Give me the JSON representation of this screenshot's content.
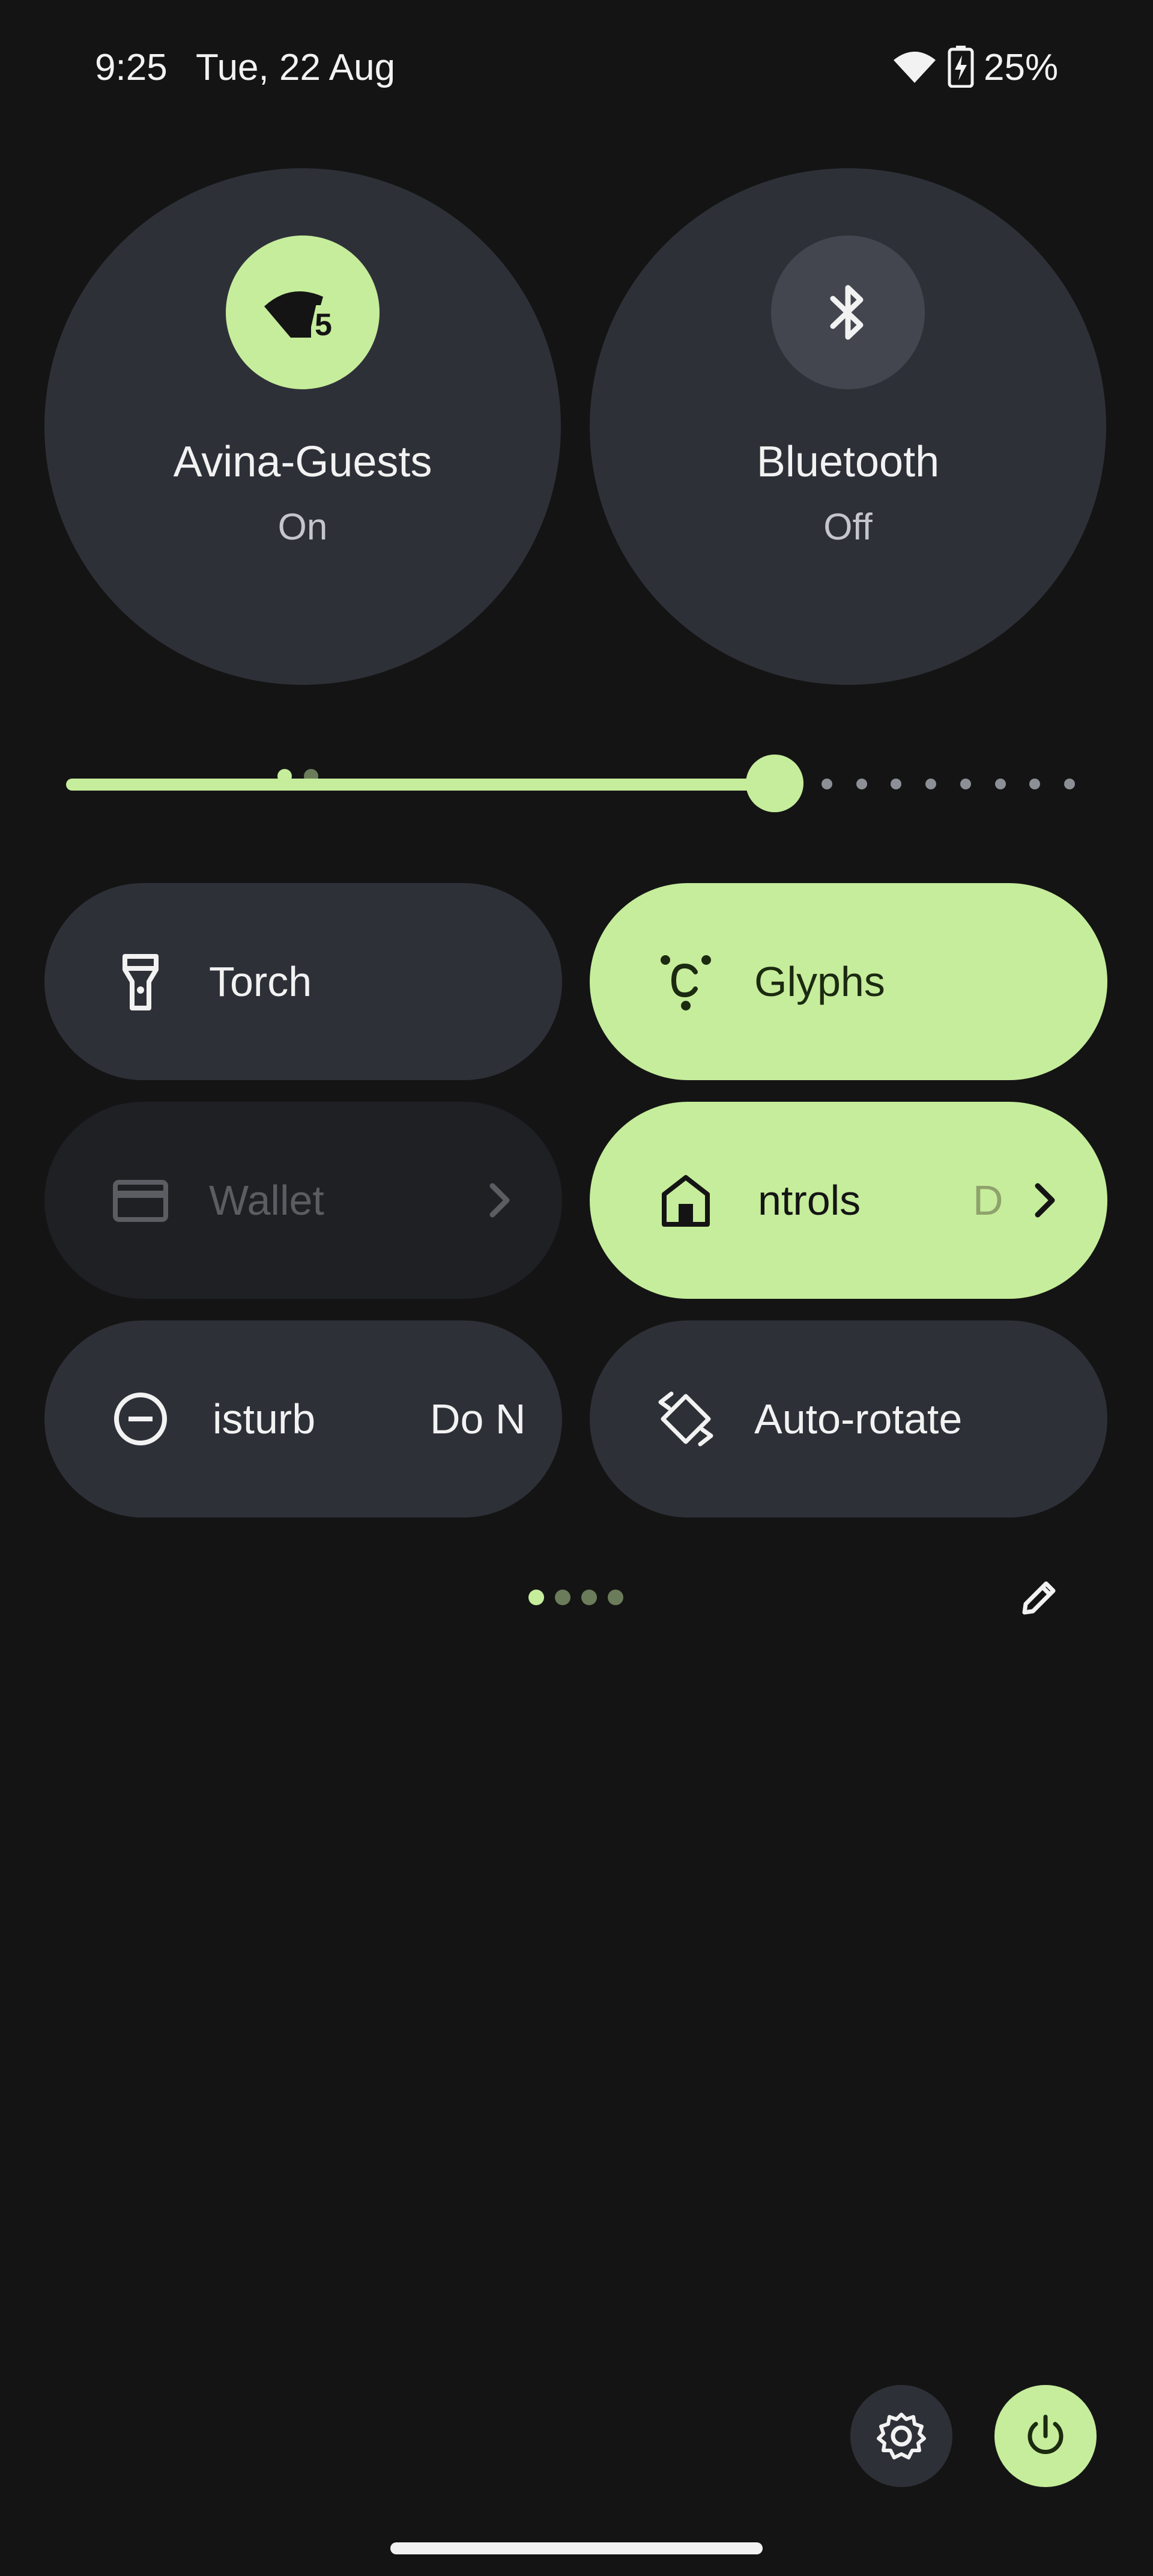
{
  "status_bar": {
    "time": "9:25",
    "date": "Tue, 22 Aug",
    "battery": "25%",
    "wifi_icon": "wifi-icon",
    "battery_icon": "battery-charging-icon"
  },
  "wifi_tile": {
    "title": "Avina-Guests",
    "state": "On",
    "badge": "5",
    "icon": "wifi-5-icon",
    "pages": [
      true,
      false
    ]
  },
  "bluetooth_tile": {
    "title": "Bluetooth",
    "state": "Off",
    "icon": "bluetooth-icon"
  },
  "brightness": {
    "level": 0.74,
    "step_dots": 8
  },
  "tiles": {
    "torch": {
      "label": "Torch",
      "icon": "flashlight-icon",
      "active": false
    },
    "glyphs": {
      "label": "Glyphs",
      "icon": "glyph-icon",
      "active": true
    },
    "wallet": {
      "label": "Wallet",
      "icon": "credit-card-icon",
      "disabled": true
    },
    "controls": {
      "label": "ntrols",
      "trailing": "D",
      "icon": "home-icon",
      "active": true
    },
    "dnd": {
      "label": "isturb",
      "trailing": "Do N",
      "icon": "do-not-disturb-icon",
      "active": false
    },
    "rotate": {
      "label": "Auto-rotate",
      "icon": "auto-rotate-icon",
      "active": false
    }
  },
  "qs_pages": {
    "count": 4,
    "current": 0
  },
  "colors": {
    "accent": "#c6ed9b",
    "tile": "#2e3038",
    "background": "#141414"
  }
}
